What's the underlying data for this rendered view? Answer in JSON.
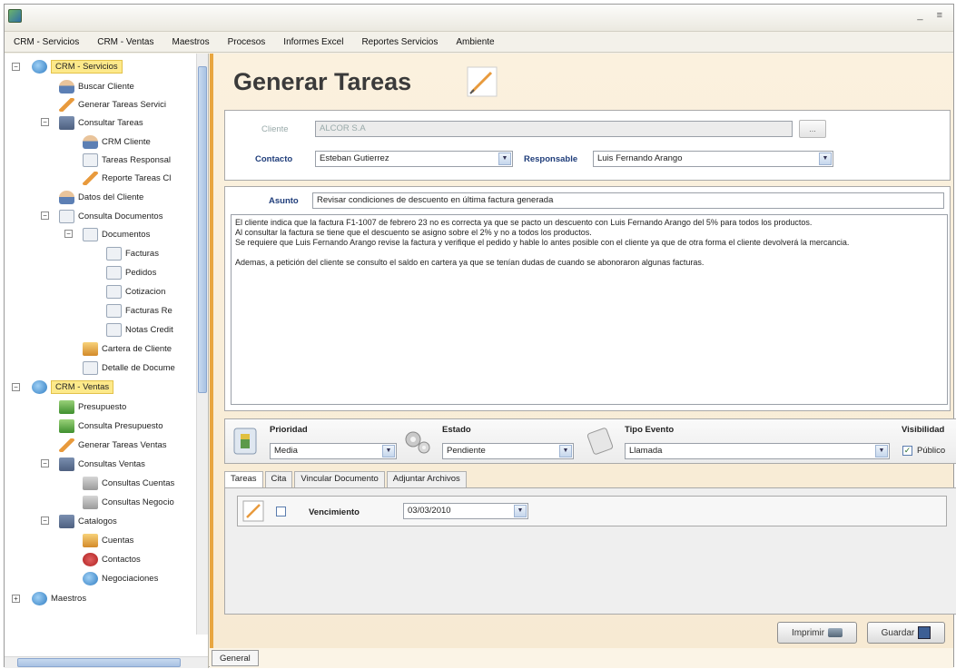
{
  "menubar": [
    "CRM - Servicios",
    "CRM - Ventas",
    "Maestros",
    "Procesos",
    "Informes Excel",
    "Reportes Servicios",
    "Ambiente"
  ],
  "window_controls": "_ ≡",
  "sidebar": {
    "nodes": [
      {
        "label": "CRM - Servicios",
        "icon": "crm-services-icon",
        "level": 0
      },
      {
        "label": "Buscar Cliente",
        "icon": "search-client-icon",
        "level": 1
      },
      {
        "label": "Generar Tareas Servici",
        "icon": "pencil-icon",
        "level": 1
      },
      {
        "label": "Consultar Tareas",
        "icon": "book-icon",
        "level": 1
      },
      {
        "label": "CRM Cliente",
        "icon": "user-icon",
        "level": 2
      },
      {
        "label": "Tareas Responsal",
        "icon": "task-icon",
        "level": 2
      },
      {
        "label": "Reporte Tareas Cl",
        "icon": "report-icon",
        "level": 2
      },
      {
        "label": "Datos del Cliente",
        "icon": "person-icon",
        "level": 1
      },
      {
        "label": "Consulta Documentos",
        "icon": "documents-icon",
        "level": 1
      },
      {
        "label": "Documentos",
        "icon": "folder-icon",
        "level": 2
      },
      {
        "label": "Facturas",
        "icon": "document-icon",
        "level": 3
      },
      {
        "label": "Pedidos",
        "icon": "document-icon",
        "level": 3
      },
      {
        "label": "Cotizacion",
        "icon": "document-icon",
        "level": 3
      },
      {
        "label": "Facturas Re",
        "icon": "document-icon",
        "level": 3
      },
      {
        "label": "Notas Credit",
        "icon": "document-icon",
        "level": 3
      },
      {
        "label": "Cartera de Cliente",
        "icon": "wallet-icon",
        "level": 2
      },
      {
        "label": "Detalle de Docume",
        "icon": "document-icon",
        "level": 2
      },
      {
        "label": "CRM - Ventas",
        "icon": "crm-sales-icon",
        "level": 0
      },
      {
        "label": "Presupuesto",
        "icon": "budget-icon",
        "level": 1
      },
      {
        "label": "Consulta Presupuesto",
        "icon": "budget-query-icon",
        "level": 1
      },
      {
        "label": "Generar Tareas Ventas",
        "icon": "pencil-icon",
        "level": 1
      },
      {
        "label": "Consultas Ventas",
        "icon": "sales-query-icon",
        "level": 1
      },
      {
        "label": "Consultas Cuentas",
        "icon": "chart-icon",
        "level": 2
      },
      {
        "label": "Consultas Negocio",
        "icon": "chart-icon",
        "level": 2
      },
      {
        "label": "Catalogos",
        "icon": "catalog-icon",
        "level": 1
      },
      {
        "label": "Cuentas",
        "icon": "accounts-icon",
        "level": 2
      },
      {
        "label": "Contactos",
        "icon": "contacts-icon",
        "level": 2
      },
      {
        "label": "Negociaciones",
        "icon": "negotiation-icon",
        "level": 2
      },
      {
        "label": "Maestros",
        "icon": "masters-icon",
        "level": 0
      }
    ]
  },
  "main": {
    "title": "Generar Tareas",
    "cliente_label": "Cliente",
    "cliente_value": "ALCOR S.A",
    "cliente_btn": "...",
    "contacto_label": "Contacto",
    "contacto_value": "Esteban Gutierrez",
    "responsable_label": "Responsable",
    "responsable_value": "Luis Fernando Arango",
    "asunto_label": "Asunto",
    "asunto_value": "Revisar condiciones de descuento en última factura generada",
    "body_lines": [
      "El cliente indica que la factura F1-1007 de febrero 23 no es correcta ya que se pacto un descuento con Luis Fernando Arango del 5% para todos los productos.",
      "Al consultar la factura se tiene que el descuento se asigno sobre el 2% y no a todos los productos.",
      "Se requiere que Luis Fernando Arango revise la factura y verifique el pedido y hable lo antes posible con el cliente ya que de otra forma el cliente devolverá la mercancia.",
      "",
      "Ademas, a petición del cliente se consulto el saldo en cartera ya que se tenían dudas de cuando se abonoraron algunas facturas."
    ],
    "prioridad_label": "Prioridad",
    "prioridad_value": "Media",
    "estado_label": "Estado",
    "estado_value": "Pendiente",
    "tipo_evento_label": "Tipo Evento",
    "tipo_evento_value": "Llamada",
    "visibilidad_label": "Visibilidad",
    "publico_label": "Público",
    "publico_checked": true,
    "tabs": [
      "Tareas",
      "Cita",
      "Vincular Documento",
      "Adjuntar Archivos"
    ],
    "active_tab": "Tareas",
    "vencimiento_label": "Vencimiento",
    "vencimiento_value": "03/03/2010",
    "imprimir": "Imprimir",
    "guardar": "Guardar",
    "status_tab": "General"
  },
  "colors": {
    "accent_orange": "#e8a640",
    "highlight_yellow": "#fde98a",
    "label_blue": "#1f3d7a"
  }
}
